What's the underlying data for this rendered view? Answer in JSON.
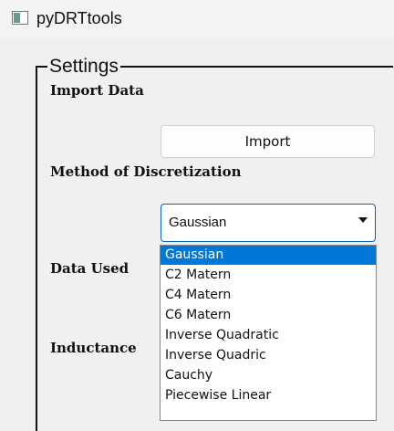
{
  "window": {
    "title": "pyDRTtools",
    "icon": "window-app-icon"
  },
  "settings": {
    "group_title": "Settings",
    "import_heading": "Import Data",
    "import_button": "Import",
    "discretization_heading": "Method of Discretization",
    "data_used_heading": "Data Used",
    "inductance_heading": "Inductance",
    "discretization_select": {
      "value": "Gaussian",
      "options": [
        "Gaussian",
        "C2 Matern",
        "C4 Matern",
        "C6 Matern",
        "Inverse Quadratic",
        "Inverse Quadric",
        "Cauchy",
        "Piecewise Linear"
      ],
      "highlighted_index": 0
    }
  },
  "colors": {
    "accent": "#0078d7",
    "focus_border": "#0067c0"
  }
}
